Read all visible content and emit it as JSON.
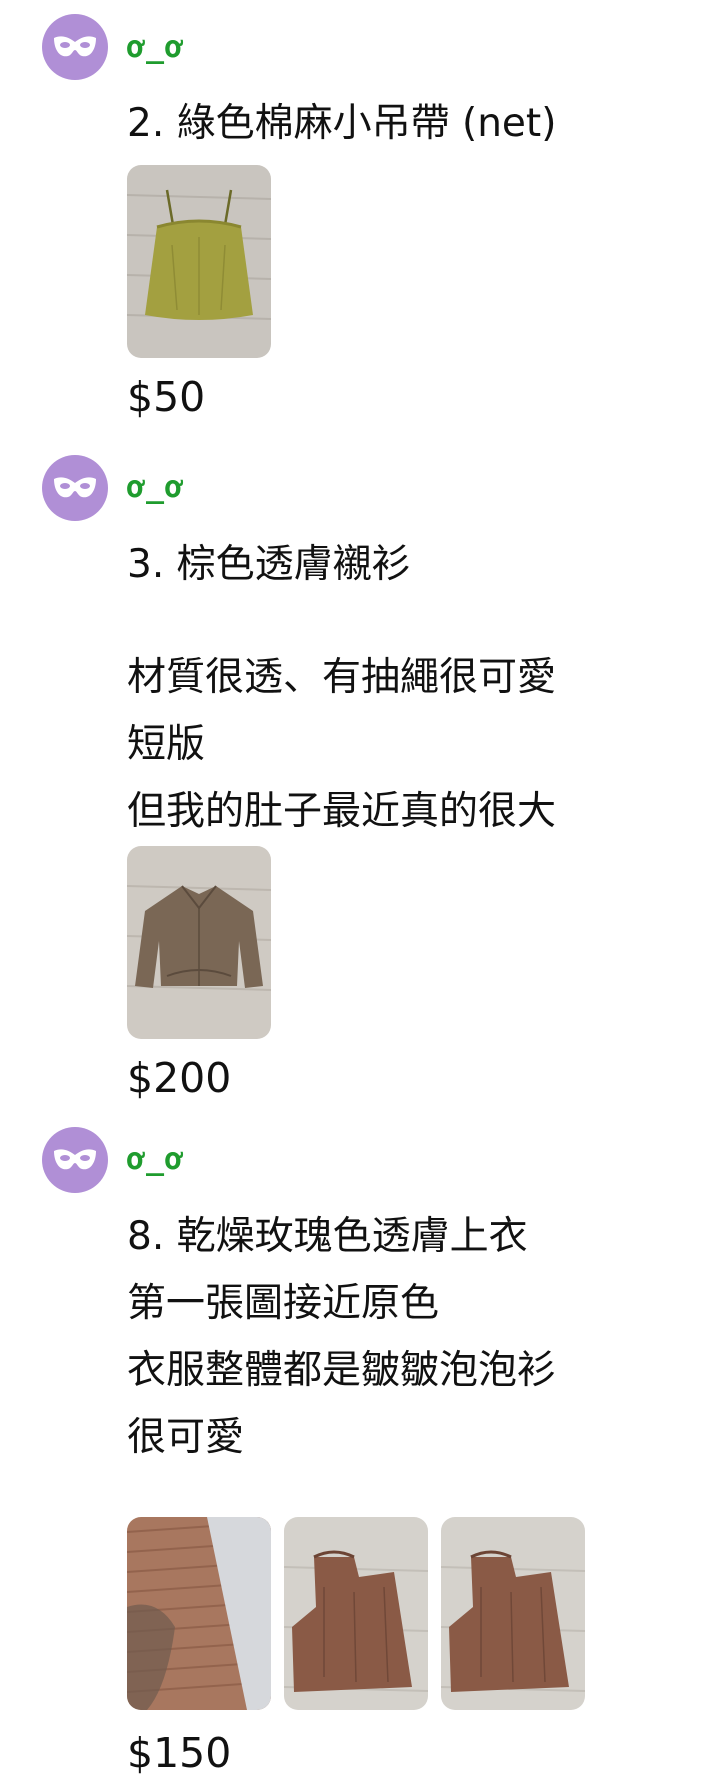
{
  "posts": [
    {
      "username": "ơ_ơ",
      "lines": [
        "2. 綠色棉麻小吊帶 (net)"
      ],
      "images": [
        {
          "icon": "green-camisole-photo"
        }
      ],
      "price": "$50"
    },
    {
      "username": "ơ_ơ",
      "lines": [
        "3. 棕色透膚襯衫",
        "材質很透、有抽繩很可愛",
        "短版",
        "但我的肚子最近真的很大"
      ],
      "images": [
        {
          "icon": "brown-sheer-shirt-photo"
        }
      ],
      "price": "$200"
    },
    {
      "username": "ơ_ơ",
      "lines": [
        "8. 乾燥玫瑰色透膚上衣",
        "第一張圖接近原色",
        "衣服整體都是皺皺泡泡衫",
        "很可愛"
      ],
      "images": [
        {
          "icon": "rose-fabric-closeup-photo"
        },
        {
          "icon": "rose-top-folded-photo"
        },
        {
          "icon": "rose-top-folded-photo-2"
        }
      ],
      "price": "$150"
    }
  ],
  "colors": {
    "avatar": "#b08fd6",
    "username": "#1f9c2e"
  }
}
